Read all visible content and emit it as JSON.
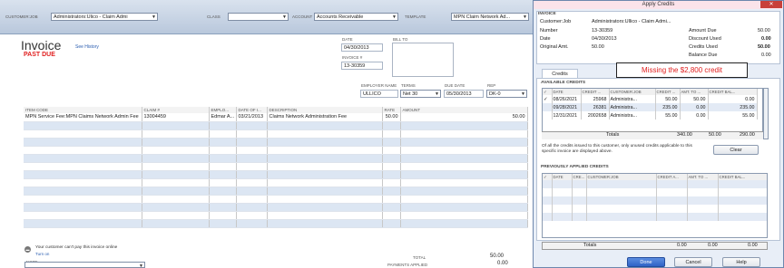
{
  "header": {
    "customer_job_label": "CUSTOMER:JOB",
    "customer_job_value": "Administrators:Ulico - Claim Admi",
    "class_label": "CLASS",
    "account_label": "ACCOUNT",
    "account_value": "Accounts Receivable",
    "template_label": "TEMPLATE",
    "template_value": "MPN Claim Network Ad..."
  },
  "invoice": {
    "title": "Invoice",
    "see_history": "See History",
    "status": "PAST DUE",
    "date_label": "DATE",
    "date_value": "04/30/2013",
    "invoice_no_label": "INVOICE #",
    "invoice_no_value": "13-30359",
    "bill_to_label": "BILL TO"
  },
  "terms": {
    "employer_label": "EMPLOYER NAME",
    "employer_value": "ULLICO",
    "terms_label": "TERMS",
    "terms_value": "Net 30",
    "due_date_label": "DUE DATE",
    "due_date_value": "05/30/2013",
    "rep_label": "REP",
    "rep_value": "DK-0"
  },
  "line_items": {
    "headers": [
      "ITEM CODE",
      "CLAIM #",
      "EMPLO...",
      "DATE OF I...",
      "DESCRIPTION",
      "RATE",
      "AMOUNT"
    ],
    "rows": [
      {
        "item": "MPN Service Fee:MPN Claims Network Admin Fee",
        "claim": "13004459",
        "emp": "Edmar A...",
        "date": "03/21/2013",
        "desc": "Claims Network Administration Fee",
        "rate": "50.00",
        "amount": "50.00"
      }
    ]
  },
  "footer": {
    "online_pay_text": "Your customer can't pay this invoice online",
    "turn_on": "Turn on",
    "note_label": "NOTE",
    "total_label": "TOTAL",
    "total_value": "50.00",
    "payments_label": "PAYMENTS APPLIED",
    "payments_value": "0.00",
    "balance_label": "BALANCE DUE",
    "balance_value": "50.00"
  },
  "dialog": {
    "title": "Apply Credits",
    "close": "✕",
    "section": "INVOICE",
    "customer_job_label": "Customer:Job",
    "customer_job_value": "Administrators:Ullico - Claim Admi...",
    "number_label": "Number",
    "number_value": "13-30359",
    "date_label": "Date",
    "date_value": "04/30/2013",
    "orig_label": "Original Amt.",
    "orig_value": "50.00",
    "amount_due_label": "Amount Due",
    "amount_due_value": "50.00",
    "discount_used_label": "Discount Used",
    "discount_used_value": "0.00",
    "credits_used_label": "Credits Used",
    "credits_used_value": "50.00",
    "balance_due_label": "Balance Due",
    "balance_due_value": "0.00",
    "tab_credits": "Credits",
    "available_label": "AVAILABLE CREDITS",
    "avail_headers": [
      "✓",
      "DATE",
      "CREDIT ...",
      "CUSTOMER:JOB",
      "CREDIT ...",
      "AMT. TO ...",
      "CREDIT BAL..."
    ],
    "avail_rows": [
      {
        "check": "✓",
        "date": "08/26/2021",
        "credit_no": "25968",
        "job": "Administra...",
        "amount": "50.00",
        "amt_to_use": "50.00",
        "bal": "0.00"
      },
      {
        "check": "",
        "date": "09/28/2021",
        "credit_no": "26381",
        "job": "Administra...",
        "amount": "235.00",
        "amt_to_use": "0.00",
        "bal": "235.00"
      },
      {
        "check": "",
        "date": "12/31/2021",
        "credit_no": "2002658",
        "job": "Administra...",
        "amount": "55.00",
        "amt_to_use": "0.00",
        "bal": "55.00"
      }
    ],
    "totals_label": "Totals",
    "totals_amount": "340.00",
    "totals_used": "50.00",
    "totals_bal": "290.00",
    "info_text": "Of all the credits issued to this customer, only unused credits applicable to this specific invoice are displayed above.",
    "clear": "Clear",
    "prev_label": "PREVIOUSLY APPLIED CREDITS",
    "prev_headers": [
      "✓",
      "DATE",
      "CRE...",
      "CUSTOMER:JOB",
      "CREDIT A...",
      "AMT. TO ...",
      "CREDIT BAL..."
    ],
    "prev_totals_label": "Totals",
    "prev_t1": "0.00",
    "prev_t2": "0.00",
    "prev_t3": "0.00",
    "done": "Done",
    "cancel": "Cancel",
    "help": "Help"
  },
  "annotation": {
    "text": "Missing the $2,800 credit"
  },
  "colors": {
    "past_due": "#e02020",
    "accent": "#2f63c6"
  }
}
